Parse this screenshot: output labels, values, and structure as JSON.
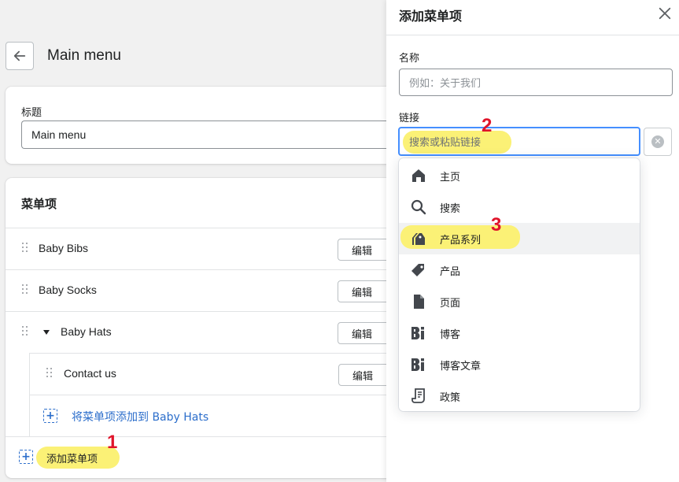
{
  "page": {
    "title": "Main menu",
    "title_field": {
      "label": "标题",
      "value": "Main menu"
    },
    "menu_items": {
      "heading": "菜单项",
      "rows": [
        {
          "label": "Baby Bibs",
          "edit": "编辑"
        },
        {
          "label": "Baby Socks",
          "edit": "编辑"
        },
        {
          "label": "Baby Hats",
          "edit": "编辑"
        }
      ],
      "nested_rows": [
        {
          "label": "Contact us",
          "edit": "编辑"
        }
      ],
      "add_nested_link": "将菜单项添加到 Baby Hats",
      "add_item_link": "添加菜单项"
    }
  },
  "panel": {
    "title": "添加菜单项",
    "name_label": "名称",
    "name_placeholder": "例如：关于我们",
    "link_label": "链接",
    "link_placeholder": "搜索或粘贴链接",
    "dropdown_items": [
      {
        "label": "主页",
        "icon": "home-icon"
      },
      {
        "label": "搜索",
        "icon": "search-icon"
      },
      {
        "label": "产品系列",
        "icon": "collection-tag-icon"
      },
      {
        "label": "产品",
        "icon": "tag-icon"
      },
      {
        "label": "页面",
        "icon": "page-icon"
      },
      {
        "label": "博客",
        "icon": "blog-icon"
      },
      {
        "label": "博客文章",
        "icon": "blog-post-icon"
      },
      {
        "label": "政策",
        "icon": "policy-icon"
      }
    ]
  },
  "annotations": {
    "step1": "1",
    "step2": "2",
    "step3": "3"
  },
  "colors": {
    "accent": "#2c6ecb",
    "focus": "#458fff",
    "highlight": "#fbf176",
    "marker": "#e0142a"
  }
}
